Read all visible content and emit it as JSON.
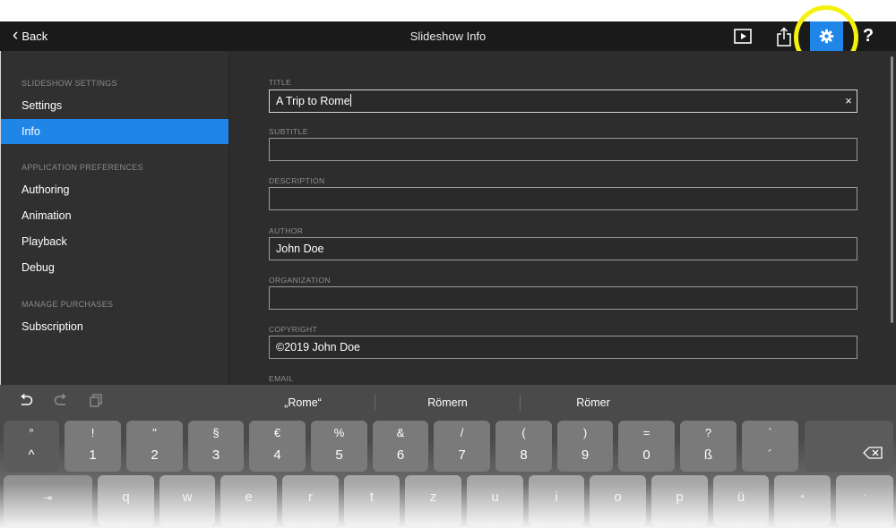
{
  "topbar": {
    "back_label": "Back",
    "title": "Slideshow Info",
    "help_label": "?"
  },
  "sidebar": {
    "sections": [
      {
        "header": "SLIDESHOW SETTINGS",
        "items": [
          {
            "label": "Settings"
          },
          {
            "label": "Info",
            "active": true
          }
        ]
      },
      {
        "header": "APPLICATION PREFERENCES",
        "items": [
          {
            "label": "Authoring"
          },
          {
            "label": "Animation"
          },
          {
            "label": "Playback"
          },
          {
            "label": "Debug"
          }
        ]
      },
      {
        "header": "MANAGE PURCHASES",
        "items": [
          {
            "label": "Subscription"
          }
        ]
      }
    ]
  },
  "form": {
    "fields": [
      {
        "label": "TITLE",
        "value": "A Trip to Rome",
        "focused": true
      },
      {
        "label": "SUBTITLE",
        "value": ""
      },
      {
        "label": "DESCRIPTION",
        "value": ""
      },
      {
        "label": "AUTHOR",
        "value": "John Doe"
      },
      {
        "label": "ORGANIZATION",
        "value": ""
      },
      {
        "label": "COPYRIGHT",
        "value": "©2019 John Doe"
      },
      {
        "label": "EMAIL",
        "value": ""
      }
    ],
    "clear_glyph": "×"
  },
  "keyboard": {
    "suggestions": [
      "„Rome“",
      "Römern",
      "Römer"
    ],
    "number_row": [
      {
        "top": "°",
        "bottom": "^"
      },
      {
        "top": "!",
        "bottom": "1"
      },
      {
        "top": "\"",
        "bottom": "2"
      },
      {
        "top": "§",
        "bottom": "3"
      },
      {
        "top": "€",
        "bottom": "4"
      },
      {
        "top": "%",
        "bottom": "5"
      },
      {
        "top": "&",
        "bottom": "6"
      },
      {
        "top": "/",
        "bottom": "7"
      },
      {
        "top": "(",
        "bottom": "8"
      },
      {
        "top": ")",
        "bottom": "9"
      },
      {
        "top": "=",
        "bottom": "0"
      },
      {
        "top": "?",
        "bottom": "ß"
      },
      {
        "top": "`",
        "bottom": "´"
      }
    ],
    "letter_row": [
      "q",
      "w",
      "e",
      "r",
      "t",
      "z",
      "u",
      "i",
      "o",
      "p",
      "ü"
    ],
    "letter_row_extra": [
      {
        "top": "*",
        "bottom": "+"
      },
      {
        "top": "'",
        "bottom": "#"
      }
    ],
    "tab_label": "⇥"
  },
  "colors": {
    "accent": "#1f86e8",
    "highlight_ring": "#f4f20c",
    "sidebar_bg": "#303030",
    "content_bg": "#2d2d2d",
    "titlebar_bg": "#1a1a1a"
  },
  "icons": {
    "back": "chevron-left-icon",
    "play": "play-icon",
    "share": "share-icon",
    "settings": "gear-icon",
    "help": "help-icon",
    "clear": "close-icon",
    "undo": "undo-icon",
    "redo": "redo-icon",
    "paste": "paste-icon",
    "backspace": "backspace-icon"
  }
}
